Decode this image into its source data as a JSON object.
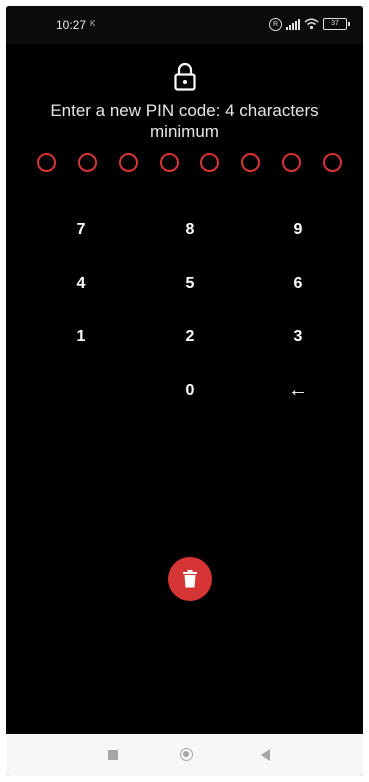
{
  "status_bar": {
    "time": "10:27",
    "notification": "K",
    "registered_mark": "R",
    "battery": "37",
    "icons": [
      "registered-icon",
      "signal-icon",
      "wifi-icon",
      "battery-icon"
    ]
  },
  "pin_screen": {
    "icon": "lock-icon",
    "title": "Enter a new PIN code: 4 characters minimum",
    "pin_length_slots": 8,
    "pin_filled": 0,
    "accent_color": "#d63535"
  },
  "keypad": {
    "keys": [
      "7",
      "8",
      "9",
      "4",
      "5",
      "6",
      "1",
      "2",
      "3",
      "0"
    ],
    "backspace": "←"
  },
  "actions": {
    "delete_icon": "trash-icon"
  },
  "nav_bar": {
    "icons": [
      "recents-icon",
      "home-icon",
      "back-icon"
    ]
  }
}
